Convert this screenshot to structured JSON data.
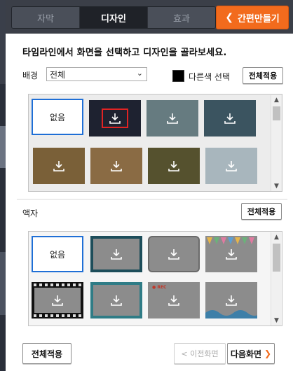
{
  "tabs": [
    {
      "label": "자막",
      "active": false
    },
    {
      "label": "디자인",
      "active": true
    },
    {
      "label": "효과",
      "active": false
    }
  ],
  "quick_button": {
    "label": "간편만들기",
    "icon": "chevron-left-icon"
  },
  "headline": "타임라인에서 화면을 선택하고 디자인을 골라보세요.",
  "background": {
    "label": "배경",
    "select_value": "전체",
    "color_label": "다른색 선택",
    "color_value": "#000000",
    "apply_all": "전체적용",
    "none_label": "없음"
  },
  "frame": {
    "label": "액자",
    "apply_all": "전체적용",
    "none_label": "없음",
    "rec_label": "● REC"
  },
  "footer": {
    "apply_all": "전체적용",
    "prev": "< 이전화면",
    "next": "다음화면",
    "next_icon": "chevron-right-icon"
  },
  "colors": {
    "accent": "#f26b1d",
    "selected_border": "#1f6fd6",
    "highlight": "#e12323"
  }
}
